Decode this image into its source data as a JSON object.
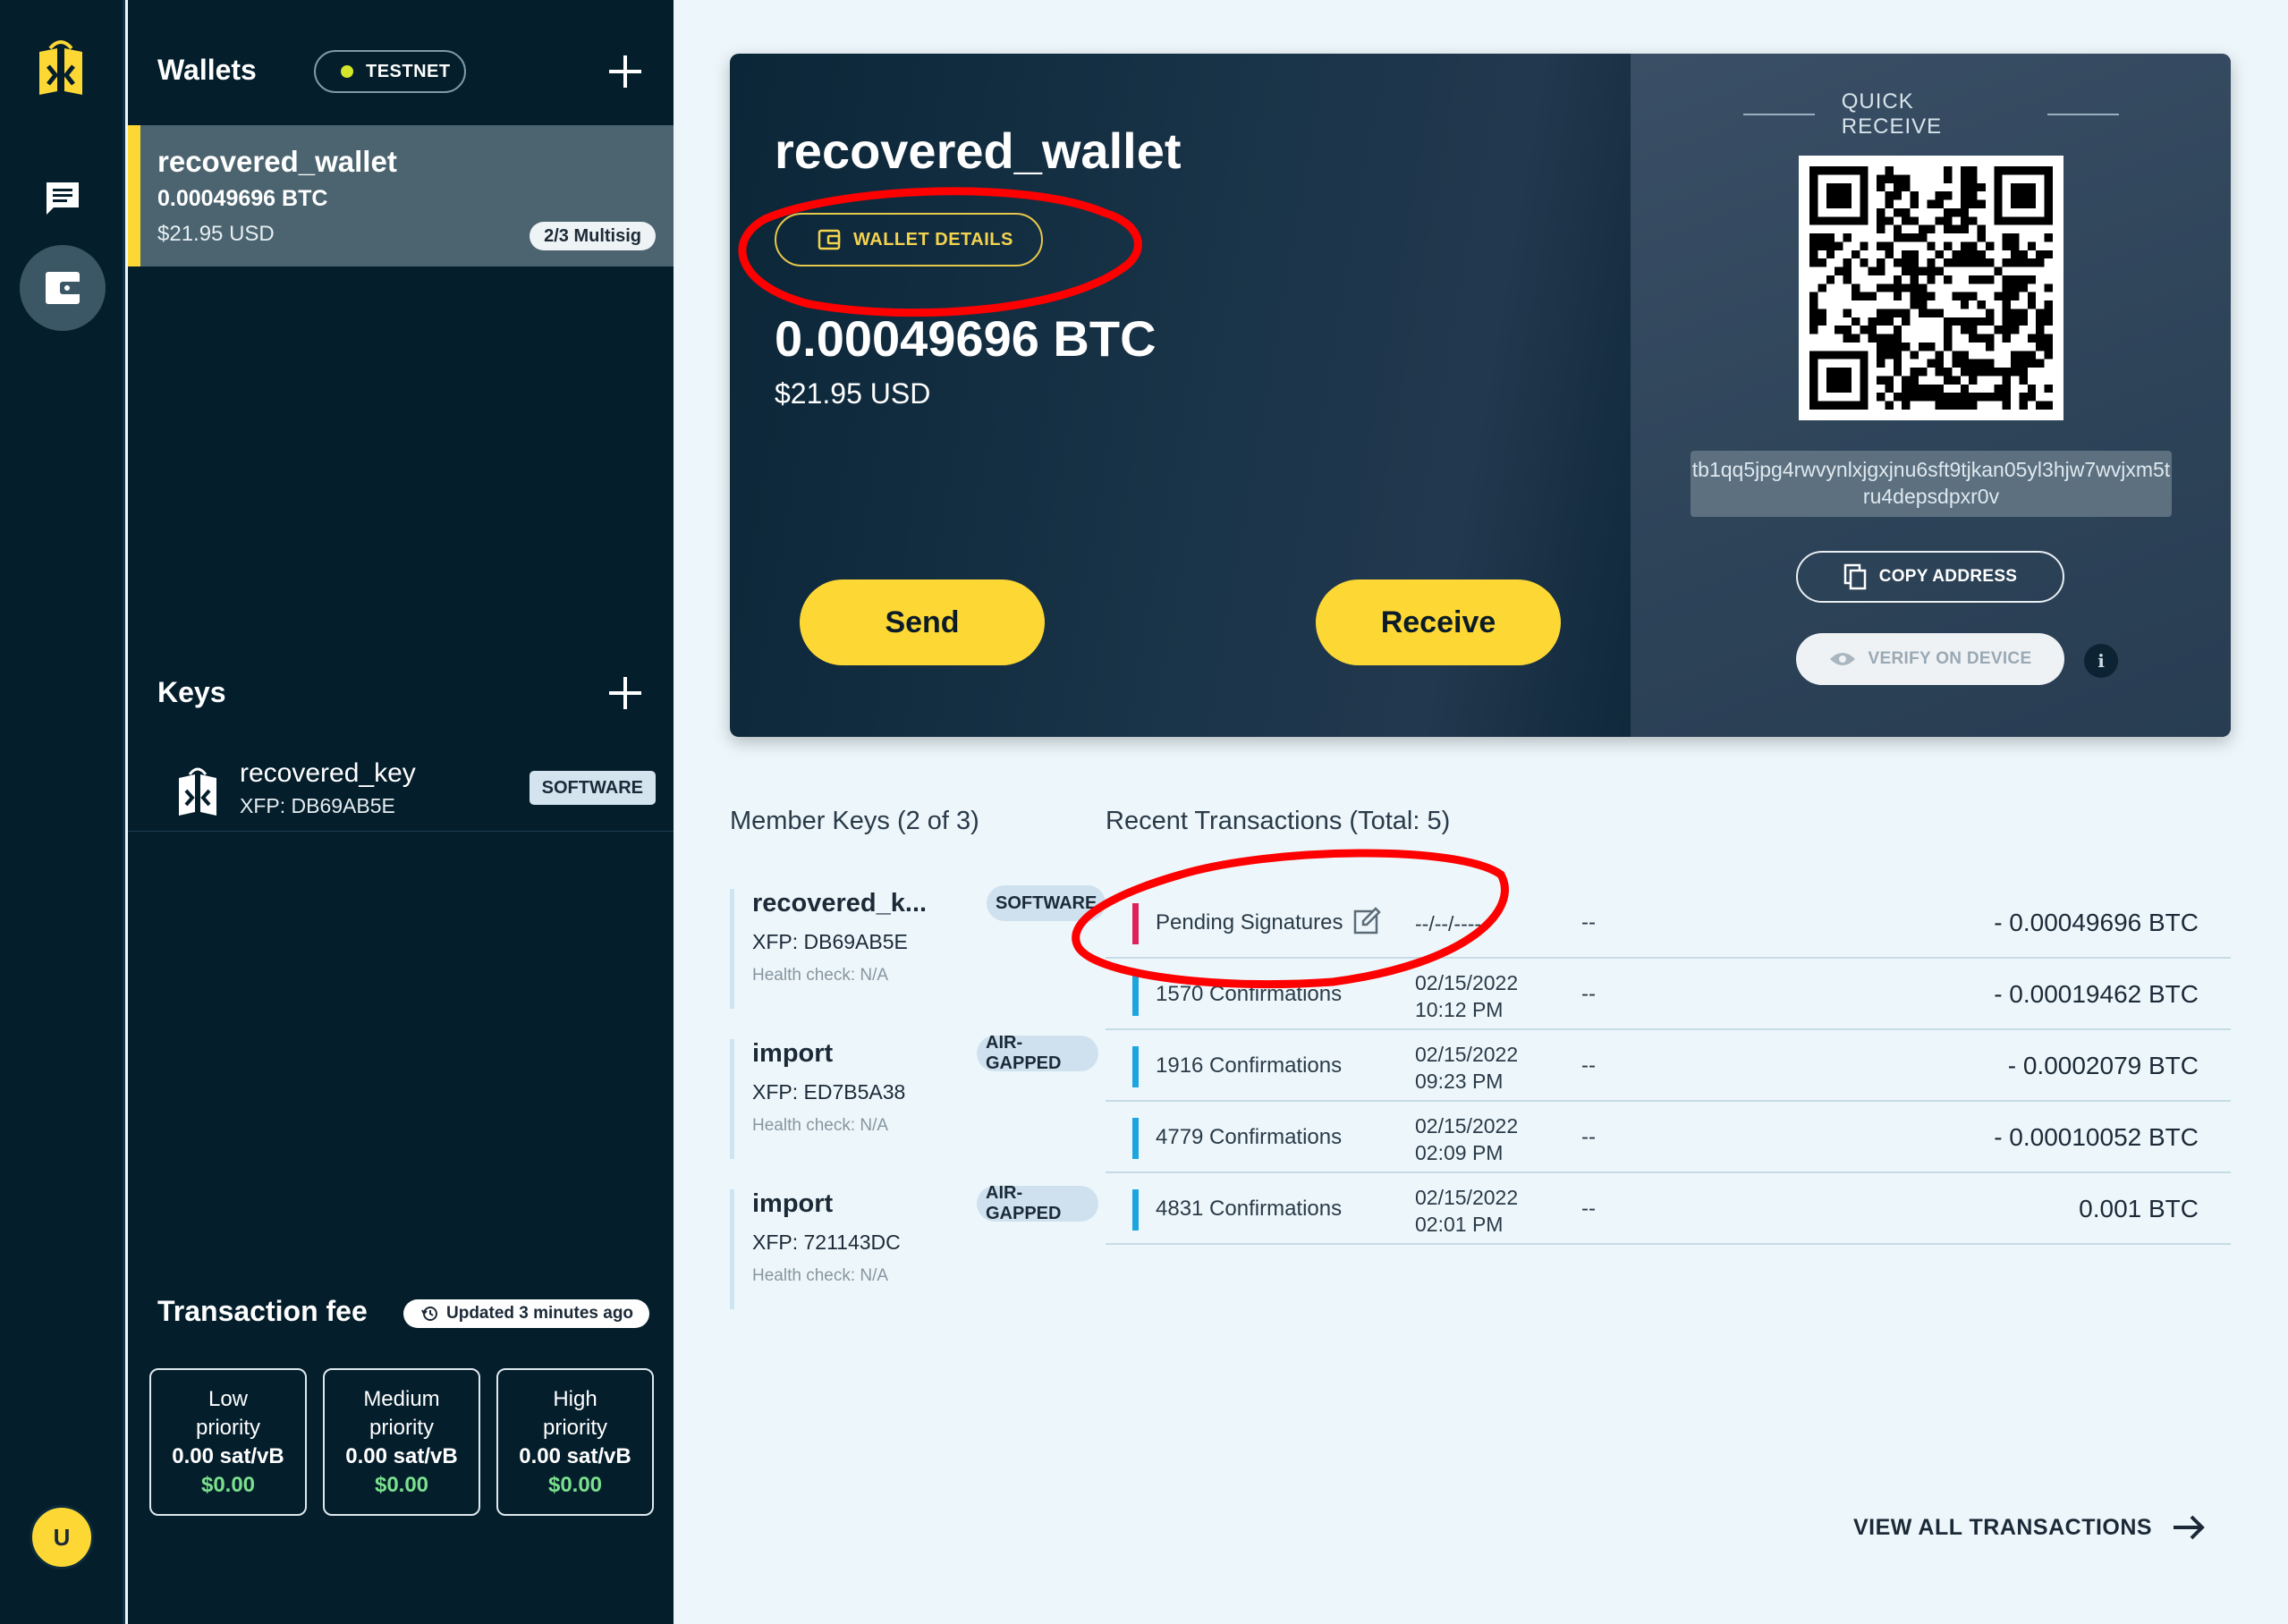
{
  "rail": {
    "avatar_initial": "U"
  },
  "sidebar": {
    "wallets_heading": "Wallets",
    "network_label": "TESTNET",
    "wallets": [
      {
        "name": "recovered_wallet",
        "btc": "0.00049696 BTC",
        "usd": "$21.95 USD",
        "badge": "2/3 Multisig"
      }
    ],
    "keys_heading": "Keys",
    "keys": [
      {
        "name": "recovered_key",
        "xfp": "XFP: DB69AB5E",
        "badge": "SOFTWARE"
      }
    ],
    "fee": {
      "title": "Transaction fee",
      "updated": "Updated 3 minutes ago",
      "options": [
        {
          "label_1": "Low",
          "label_2": "priority",
          "rate": "0.00 sat/vB",
          "usd": "$0.00"
        },
        {
          "label_1": "Medium",
          "label_2": "priority",
          "rate": "0.00 sat/vB",
          "usd": "$0.00"
        },
        {
          "label_1": "High",
          "label_2": "priority",
          "rate": "0.00 sat/vB",
          "usd": "$0.00"
        }
      ]
    }
  },
  "hero": {
    "wallet_name": "recovered_wallet",
    "details_label": "WALLET DETAILS",
    "btc_balance": "0.00049696 BTC",
    "usd_balance": "$21.95 USD",
    "send_label": "Send",
    "receive_label": "Receive",
    "quick_receive_title": "QUICK RECEIVE",
    "address": "tb1qq5jpg4rwvynlxjgxjnu6sft9tjkan05yl3hjw7wvjxm5tru4depsdpxr0v",
    "copy_label": "COPY ADDRESS",
    "verify_label": "VERIFY ON DEVICE",
    "info_glyph": "i"
  },
  "member_keys": {
    "heading": "Member Keys (2 of 3)",
    "items": [
      {
        "name": "recovered_k...",
        "xfp": "XFP: DB69AB5E",
        "health": "Health check: N/A",
        "badge": "SOFTWARE"
      },
      {
        "name": "import",
        "xfp": "XFP: ED7B5A38",
        "health": "Health check: N/A",
        "badge": "AIR-GAPPED"
      },
      {
        "name": "import",
        "xfp": "XFP: 721143DC",
        "health": "Health check: N/A",
        "badge": "AIR-GAPPED"
      }
    ]
  },
  "transactions": {
    "heading": "Recent Transactions (Total: 5)",
    "rows": [
      {
        "status": "Pending Signatures",
        "date": "--/--/----",
        "time": "",
        "dash": "--",
        "amount": "- 0.00049696 BTC",
        "pending": true
      },
      {
        "status": "1570 Confirmations",
        "date": "02/15/2022",
        "time": "10:12 PM",
        "dash": "--",
        "amount": "- 0.00019462 BTC",
        "pending": false
      },
      {
        "status": "1916 Confirmations",
        "date": "02/15/2022",
        "time": "09:23 PM",
        "dash": "--",
        "amount": "- 0.0002079 BTC",
        "pending": false
      },
      {
        "status": "4779 Confirmations",
        "date": "02/15/2022",
        "time": "02:09 PM",
        "dash": "--",
        "amount": "- 0.00010052 BTC",
        "pending": false
      },
      {
        "status": "4831 Confirmations",
        "date": "02/15/2022",
        "time": "02:01 PM",
        "dash": "--",
        "amount": "0.001 BTC",
        "pending": false
      }
    ],
    "view_all_label": "VIEW ALL TRANSACTIONS"
  },
  "colors": {
    "accent_yellow": "#fdd835",
    "sidebar_bg": "#041e2c",
    "pending_bar": "#e0205a",
    "confirmed_bar": "#1ea5e0",
    "annotation_red": "#ff0000",
    "fee_usd": "#7be08d"
  }
}
